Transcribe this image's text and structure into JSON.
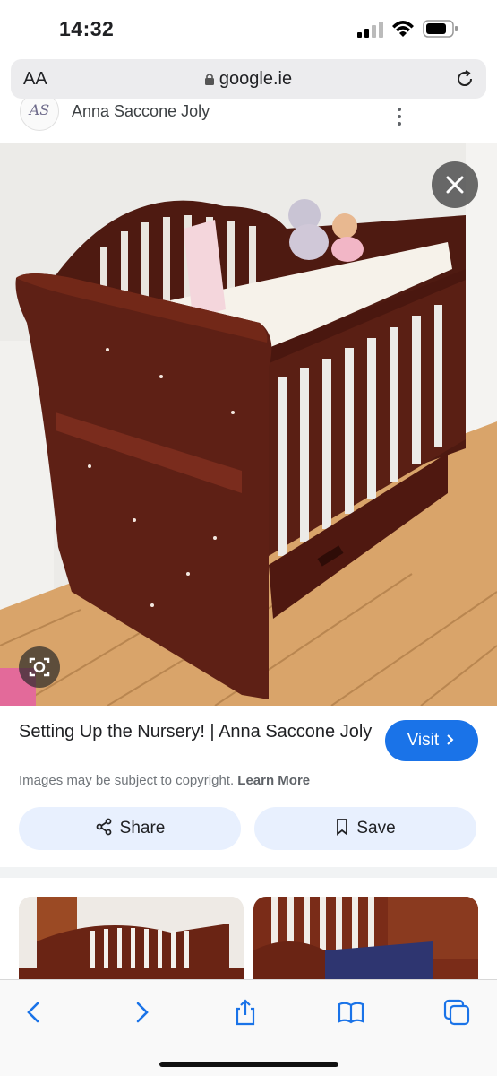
{
  "status_bar": {
    "time": "14:32"
  },
  "browser": {
    "text_size_label": "AA",
    "url": "google.ie"
  },
  "result": {
    "source_name": "Anna Saccone Joly",
    "source_logo_text": "AS",
    "title": "Setting Up the Nursery! | Anna Saccone Joly",
    "visit_label": "Visit",
    "copyright_text": "Images may be subject to copyright.",
    "learn_more_label": "Learn More",
    "share_label": "Share",
    "save_label": "Save"
  },
  "colors": {
    "accent_blue": "#1a73e8",
    "pill_background": "#e8f0fe",
    "wood_dark": "#5a1f14",
    "floor": "#d9a46a"
  },
  "icons": [
    "lock-icon",
    "reload-icon",
    "more-options-icon",
    "close-icon",
    "lens-icon",
    "share-icon",
    "bookmark-icon",
    "chevron-right-icon",
    "back-icon",
    "forward-icon",
    "share-sheet-icon",
    "bookmarks-icon",
    "tabs-icon"
  ]
}
